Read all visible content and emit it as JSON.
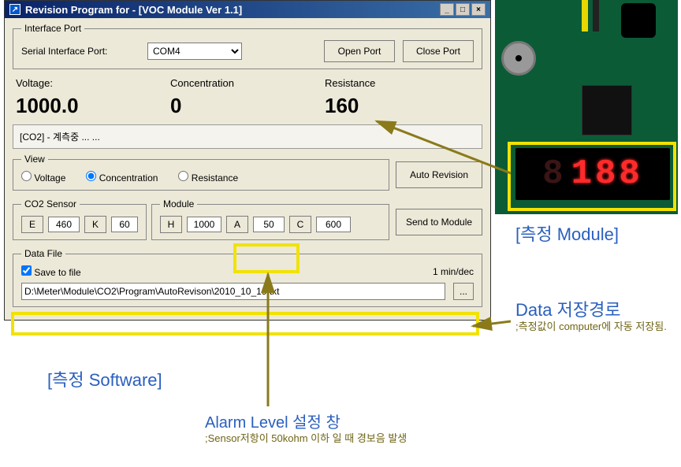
{
  "window": {
    "title": "Revision Program for - [VOC Module Ver 1.1]",
    "icon_glyph": "↗"
  },
  "interface_port": {
    "legend": "Interface Port",
    "label": "Serial Interface Port:",
    "selected": "COM4",
    "open_btn": "Open Port",
    "close_btn": "Close Port"
  },
  "readings": {
    "voltage_label": "Voltage:",
    "voltage_value": "1000.0",
    "conc_label": "Concentration",
    "conc_value": "0",
    "res_label": "Resistance",
    "res_value": "160"
  },
  "status": "[CO2] - 계측중 ... ...",
  "view": {
    "legend": "View",
    "voltage": "Voltage",
    "concentration": "Concentration",
    "resistance": "Resistance",
    "auto_rev_btn": "Auto Revision"
  },
  "co2_sensor": {
    "legend": "CO2 Sensor",
    "e_btn": "E",
    "e_val": "460",
    "k_btn": "K",
    "k_val": "60"
  },
  "module": {
    "legend": "Module",
    "h_btn": "H",
    "h_val": "1000",
    "a_btn": "A",
    "a_val": "50",
    "c_btn": "C",
    "c_val": "600",
    "send_btn": "Send to Module"
  },
  "data_file": {
    "legend": "Data File",
    "save_label": "Save to file",
    "rate": "1 min/dec",
    "path": "D:\\Meter\\Module\\CO2\\Program\\AutoRevison\\2010_10_19.txt",
    "browse": "..."
  },
  "device": {
    "display_dim": "8",
    "display_lit": "188"
  },
  "annotations": {
    "software": "[측정 Software]",
    "module": "[측정 Module]",
    "alarm_title": "Alarm Level 설정 창",
    "alarm_sub": ";Sensor저항이 50kohm 이하 일 때 경보음 발생",
    "data_path_title": "Data 저장경로",
    "data_path_sub": ";측정값이 computer에 자동 저장됨."
  }
}
